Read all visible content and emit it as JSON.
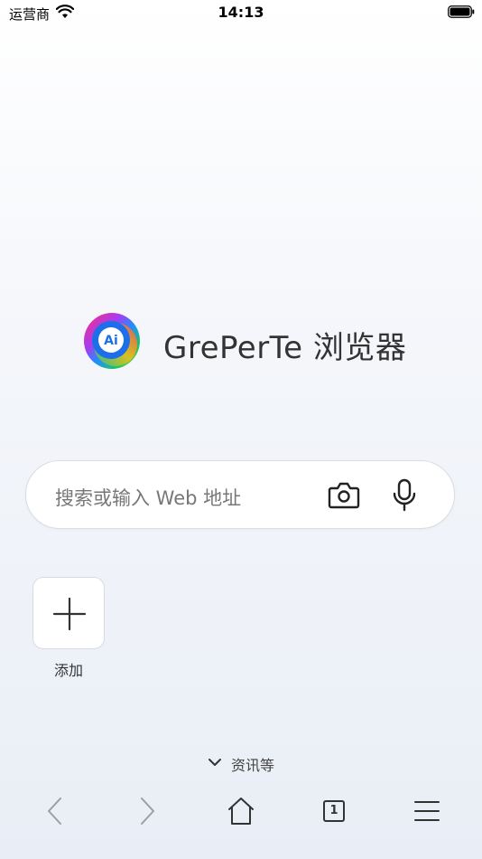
{
  "status_bar": {
    "carrier": "运营商",
    "time": "14:13"
  },
  "logo": {
    "badge_text": "Ai",
    "title": "GrePerTe 浏览器"
  },
  "search": {
    "placeholder": "搜索或输入 Web 地址"
  },
  "shortcuts": [
    {
      "label": "添加",
      "icon": "plus-icon"
    }
  ],
  "news_toggle": {
    "label": "资讯等",
    "icon": "chevron-down-icon"
  },
  "toolbar": {
    "tab_count": "1",
    "icons": [
      "back-icon",
      "forward-icon",
      "home-icon",
      "tabs-icon",
      "menu-icon"
    ]
  }
}
